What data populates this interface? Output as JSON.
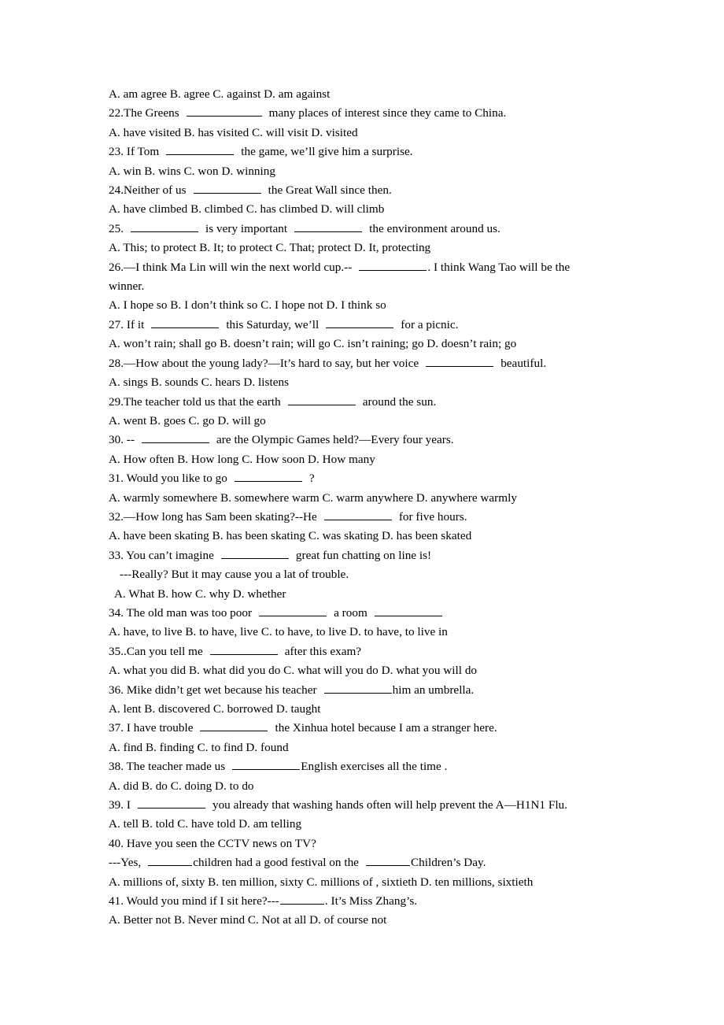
{
  "document": {
    "type": "multiple-choice-grammar-worksheet",
    "text_color": "#000000",
    "background_color": "#ffffff",
    "lines": {
      "l01_options_21": "A. am agree    B. agree      C. against    D. am against",
      "l02_q22_a": "22.The Greens",
      "l02_q22_b": "many places of interest since they came to China.",
      "l03_options_22": "A. have visited      B. has visited       C. will visit      D. visited",
      "l04_q23_a": "23. If Tom",
      "l04_q23_b": "the game, we’ll give him a surprise.",
      "l05_options_23": "A. win     B. wins      C. won     D. winning",
      "l06_q24_a": "24.Neither of us",
      "l06_q24_b": "the Great Wall since then.",
      "l07_options_24": "A. have climbed        B. climbed          C. has climbed       D. will climb",
      "l08_q25_a": "25.",
      "l08_q25_b": "is very important",
      "l08_q25_c": "the environment around us.",
      "l09_options_25": "A. This; to protect      B. It; to protect      C. That; protect       D. It, protecting",
      "l10_q26_a": "26.—I think Ma Lin will win the next world cup.--",
      "l10_q26_b": ". I think Wang Tao will be the",
      "l11_q26_cont": "winner.",
      "l12_options_26": "A. I hope so     B. I don’t think so     C. I hope not     D. I think so",
      "l13_q27_a": "27. If it",
      "l13_q27_b": "this Saturday, we’ll",
      "l13_q27_c": "for a picnic.",
      "l14_options_27": "A. won’t rain; shall go     B. doesn’t rain; will go     C. isn’t raining; go     D. doesn’t rain; go",
      "l15_q28_a": "28.—How about the young lady?—It’s hard to say, but her voice",
      "l15_q28_b": "beautiful.",
      "l16_options_28": "A. sings     B. sounds     C. hears     D. listens",
      "l17_q29_a": "29.The teacher told us that the earth",
      "l17_q29_b": "around the sun.",
      "l18_options_29": "A. went      B. goes      C. go     D. will go",
      "l19_q30_a": "30. --",
      "l19_q30_b": "are the Olympic Games held?—Every four years.",
      "l20_options_30": "A. How often     B. How long       C. How soon     D. How many",
      "l21_q31_a": "31. Would you like to go",
      "l21_q31_b": "?",
      "l22_options_31": "A. warmly somewhere       B. somewhere warm       C. warm anywhere    D. anywhere warmly",
      "l23_q32_a": "32.—How long has Sam been skating?--He",
      "l23_q32_b": "for five hours.",
      "l24_options_32": "A. have been skating     B. has been skating      C. was skating     D. has been skated",
      "l25_q33_a": "33. You can’t imagine",
      "l25_q33_b": "great fun chatting on line is!",
      "l26_q33_cont": "---Really? But it may cause you a lat of trouble.",
      "l27_options_33": "A. What        B. how      C. why        D. whether",
      "l28_q34_a": "34. The old man was too poor",
      "l28_q34_b": "a room",
      "l29_options_34": "A. have, to live     B.    to have, live     C. to have, to live   D. to have, to live in",
      "l30_q35_a": "35..Can you tell me",
      "l30_q35_b": "after this exam?",
      "l31_options_35": "A. what you did     B. what did you do    C. what will you do    D. what you will do",
      "l32_q36_a": "36. Mike didn’t get wet because his teacher",
      "l32_q36_b": "him an umbrella.",
      "l33_options_36": "A. lent        B.    discovered      C. borrowed    D. taught",
      "l34_q37_a": "37. I have trouble",
      "l34_q37_b": "the Xinhua hotel because I am a stranger here.",
      "l35_options_37": "A. find     B. finding      C. to find      D. found",
      "l36_q38_a": "38. The teacher made us",
      "l36_q38_b": "English exercises all the time .",
      "l37_options_38": "A. did      B. do        C. doing     D. to do",
      "l38_q39_a": "39. I",
      "l38_q39_b": "you already that washing hands often will help prevent the A—H1N1 Flu.",
      "l39_options_39": "A. tell      B. told      C. have told     D. am telling",
      "l40_q40": "40. Have you seen the CCTV news on TV?",
      "l41_q40_a": "---Yes,",
      "l41_q40_b": "children had a good festival on the",
      "l41_q40_c": "Children’s Day.",
      "l42_options_40": "A. millions of, sixty     B. ten million, sixty      C. millions of , sixtieth    D. ten millions, sixtieth",
      "l43_q41_a": "41. Would you mind if I sit here?---",
      "l43_q41_b": ". It’s Miss Zhang’s.",
      "l44_options_41": "A. Better not   B. Never mind      C. Not at all       D. of course not"
    }
  }
}
